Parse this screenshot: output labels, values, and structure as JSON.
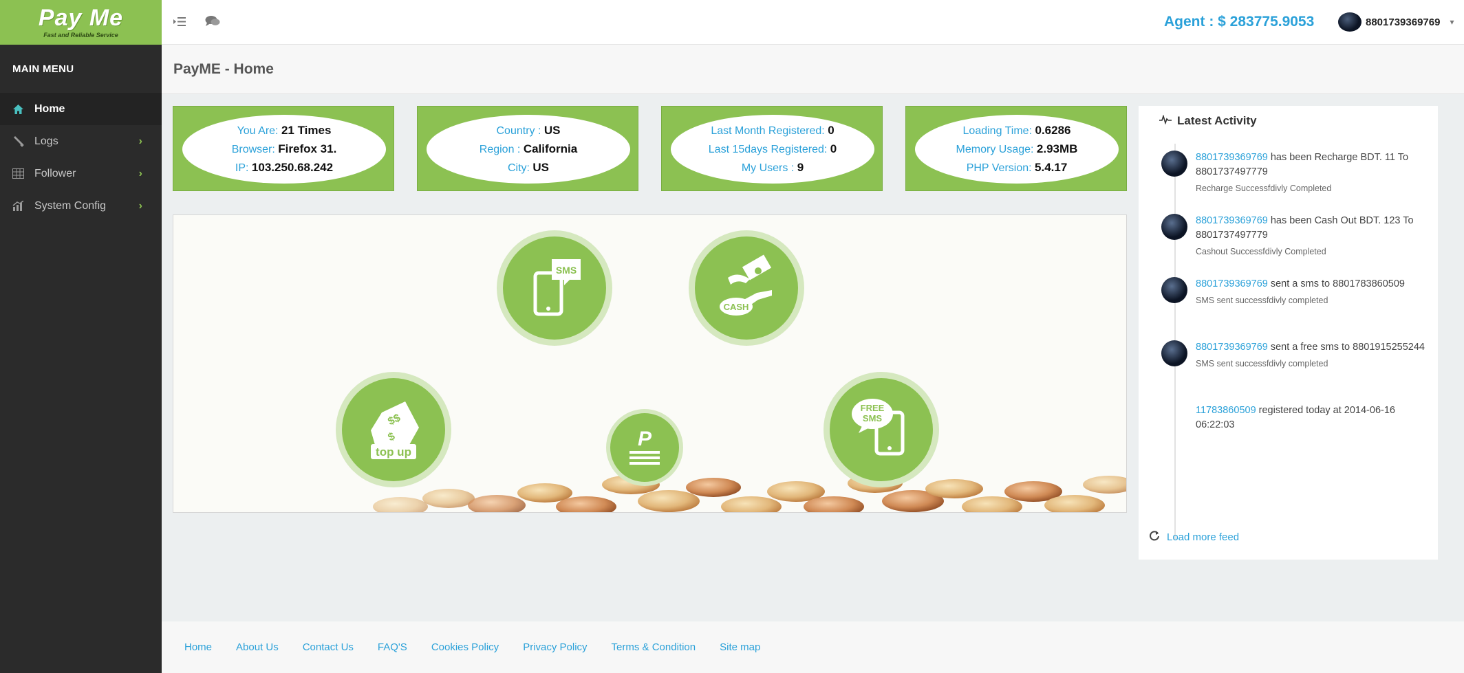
{
  "brand": {
    "name": "Pay Me",
    "tagline": "Fast and Reliable Service",
    "accent": "#8cc152",
    "link_color": "#2ba1d9"
  },
  "sidebar": {
    "title": "MAIN MENU",
    "items": [
      {
        "label": "Home",
        "icon": "home-icon",
        "active": true
      },
      {
        "label": "Logs",
        "icon": "wrench-icon",
        "has_submenu": true
      },
      {
        "label": "Follower",
        "icon": "table-icon",
        "has_submenu": true
      },
      {
        "label": "System Config",
        "icon": "chart-icon",
        "has_submenu": true
      }
    ],
    "submenu_glyph": "›"
  },
  "topbar": {
    "agent_balance": "Agent : $ 283775.9053",
    "username": "8801739369769",
    "caret": "▾"
  },
  "page": {
    "title": "PayME - Home"
  },
  "stats": [
    {
      "rows": [
        {
          "label": "You Are:",
          "value": "21 Times"
        },
        {
          "label": "Browser:",
          "value": "Firefox 31."
        },
        {
          "label": "IP:",
          "value": "103.250.68.242"
        }
      ]
    },
    {
      "rows": [
        {
          "label": "Country :",
          "value": "US"
        },
        {
          "label": "Region :",
          "value": "California"
        },
        {
          "label": "City:",
          "value": "US"
        }
      ]
    },
    {
      "rows": [
        {
          "label": "Last Month Registered:",
          "value": "0"
        },
        {
          "label": "Last 15days Registered:",
          "value": "0"
        },
        {
          "label": "My Users :",
          "value": "9"
        }
      ]
    },
    {
      "rows": [
        {
          "label": "Loading Time:",
          "value": "0.6286"
        },
        {
          "label": "Memory Usage:",
          "value": "2.93MB"
        },
        {
          "label": "PHP Version:",
          "value": "5.4.17"
        }
      ]
    }
  ],
  "services": {
    "sms": "SMS",
    "cash": "CASH",
    "topup": "top up",
    "pay": "P",
    "free_sms_1": "FREE",
    "free_sms_2": "SMS"
  },
  "activity": {
    "title": "Latest Activity",
    "items": [
      {
        "link": "8801739369769",
        "text": " has been Recharge BDT. 11 To 8801737497779",
        "sub": "Recharge Successfdivly Completed"
      },
      {
        "link": "8801739369769",
        "text": " has been Cash Out BDT. 123 To 8801737497779",
        "sub": "Cashout Successfdivly Completed"
      },
      {
        "link": "8801739369769",
        "text": " sent a sms to 8801783860509",
        "sub": "SMS sent successfdivly completed"
      },
      {
        "link": "8801739369769",
        "text": " sent a free sms to 8801915255244",
        "sub": "SMS sent successfdivly completed"
      },
      {
        "link": "11783860509",
        "text": " registered today at 2014-06-16 06:22:03",
        "sub": ""
      }
    ],
    "load_more": "Load more feed"
  },
  "footer": {
    "links": [
      "Home",
      "About Us",
      "Contact Us",
      "FAQ'S",
      "Cookies Policy",
      "Privacy Policy",
      "Terms & Condition",
      "Site map"
    ]
  }
}
